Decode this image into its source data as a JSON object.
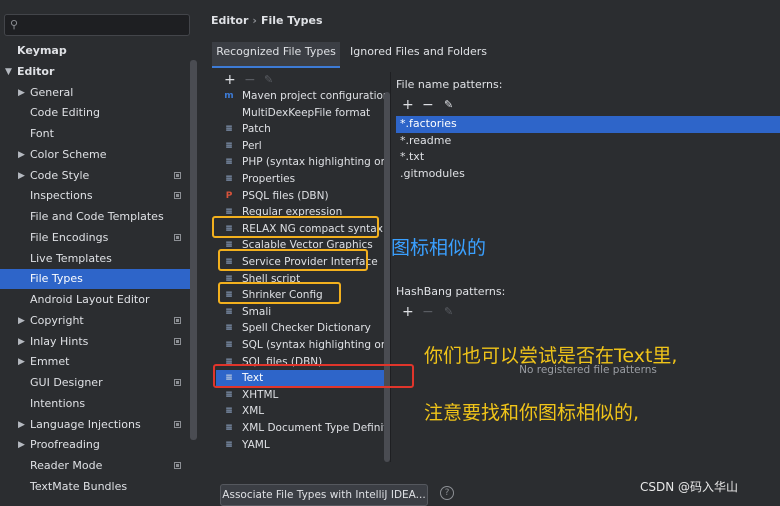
{
  "sidebar": {
    "items": [
      {
        "label": "Keymap",
        "level": 0,
        "bold": true,
        "arrow": "",
        "mark": false
      },
      {
        "label": "Editor",
        "level": 0,
        "bold": true,
        "arrow": "down",
        "mark": false
      },
      {
        "label": "General",
        "level": 1,
        "arrow": "right",
        "mark": false
      },
      {
        "label": "Code Editing",
        "level": 1,
        "arrow": "",
        "mark": false
      },
      {
        "label": "Font",
        "level": 1,
        "arrow": "",
        "mark": false
      },
      {
        "label": "Color Scheme",
        "level": 1,
        "arrow": "right",
        "mark": false
      },
      {
        "label": "Code Style",
        "level": 1,
        "arrow": "right",
        "mark": true
      },
      {
        "label": "Inspections",
        "level": 1,
        "arrow": "",
        "mark": true
      },
      {
        "label": "File and Code Templates",
        "level": 1,
        "arrow": "",
        "mark": false
      },
      {
        "label": "File Encodings",
        "level": 1,
        "arrow": "",
        "mark": true
      },
      {
        "label": "Live Templates",
        "level": 1,
        "arrow": "",
        "mark": false
      },
      {
        "label": "File Types",
        "level": 1,
        "arrow": "",
        "mark": false,
        "selected": true
      },
      {
        "label": "Android Layout Editor",
        "level": 1,
        "arrow": "",
        "mark": false
      },
      {
        "label": "Copyright",
        "level": 1,
        "arrow": "right",
        "mark": true
      },
      {
        "label": "Inlay Hints",
        "level": 1,
        "arrow": "right",
        "mark": true
      },
      {
        "label": "Emmet",
        "level": 1,
        "arrow": "right",
        "mark": false
      },
      {
        "label": "GUI Designer",
        "level": 1,
        "arrow": "",
        "mark": true
      },
      {
        "label": "Intentions",
        "level": 1,
        "arrow": "",
        "mark": false
      },
      {
        "label": "Language Injections",
        "level": 1,
        "arrow": "right",
        "mark": true
      },
      {
        "label": "Proofreading",
        "level": 1,
        "arrow": "right",
        "mark": false
      },
      {
        "label": "Reader Mode",
        "level": 1,
        "arrow": "",
        "mark": true
      },
      {
        "label": "TextMate Bundles",
        "level": 1,
        "arrow": "",
        "mark": false
      }
    ]
  },
  "breadcrumb": {
    "part1": "Editor",
    "sep": "›",
    "part2": "File Types"
  },
  "tabs": {
    "recognized": "Recognized File Types",
    "ignored": "Ignored Files and Folders"
  },
  "toolbar": {
    "add": "+",
    "remove": "−",
    "edit": "✎"
  },
  "file_types": [
    {
      "name": "Maven project configuration",
      "icon": "m",
      "color": "#3d7bd6"
    },
    {
      "name": "MultiDexKeepFile format",
      "icon": "",
      "color": "#2b2d30"
    },
    {
      "name": "Patch",
      "icon": "≡",
      "color": "#8fa6c7"
    },
    {
      "name": "Perl",
      "icon": "≡",
      "color": "#8fa6c7"
    },
    {
      "name": "PHP (syntax highlighting only)",
      "icon": "≡",
      "color": "#8fa6c7"
    },
    {
      "name": "Properties",
      "icon": "≡",
      "color": "#8fa6c7"
    },
    {
      "name": "PSQL files (DBN)",
      "icon": "P",
      "color": "#d9533b"
    },
    {
      "name": "Regular expression",
      "icon": "≡",
      "color": "#8fa6c7"
    },
    {
      "name": "RELAX NG compact syntax",
      "icon": "≡",
      "color": "#8fa6c7"
    },
    {
      "name": "Scalable Vector Graphics",
      "icon": "≡",
      "color": "#8fa6c7"
    },
    {
      "name": "Service Provider Interface",
      "icon": "≡",
      "color": "#8fa6c7"
    },
    {
      "name": "Shell script",
      "icon": "≡",
      "color": "#8fa6c7"
    },
    {
      "name": "Shrinker Config",
      "icon": "≡",
      "color": "#8fa6c7"
    },
    {
      "name": "Smali",
      "icon": "≡",
      "color": "#8fa6c7"
    },
    {
      "name": "Spell Checker Dictionary",
      "icon": "≡",
      "color": "#8fa6c7"
    },
    {
      "name": "SQL (syntax highlighting only)",
      "icon": "≡",
      "color": "#8fa6c7"
    },
    {
      "name": "SQL files (DBN)",
      "icon": "≡",
      "color": "#8fa6c7"
    },
    {
      "name": "Text",
      "icon": "≡",
      "color": "#cfd6e0",
      "selected": true
    },
    {
      "name": "XHTML",
      "icon": "≡",
      "color": "#8fa6c7"
    },
    {
      "name": "XML",
      "icon": "≡",
      "color": "#8fa6c7"
    },
    {
      "name": "XML Document Type Definition",
      "icon": "≡",
      "color": "#8fa6c7"
    },
    {
      "name": "YAML",
      "icon": "≡",
      "color": "#8fa6c7"
    }
  ],
  "patterns": {
    "title": "File name patterns:",
    "items": [
      "*.factories",
      "*.readme",
      "*.txt",
      ".gitmodules"
    ]
  },
  "hashbang": {
    "title": "HashBang patterns:",
    "empty": "No registered file patterns"
  },
  "assoc_button": "Associate File Types with IntelliJ IDEA...",
  "help": "?",
  "annotations": {
    "note1": "图标相似的",
    "note2": "你们也可以尝试是否在Text里,",
    "note3": "注意要找和你图标相似的,",
    "watermark": "CSDN @码入华山"
  },
  "colors": {
    "accent": "#2e65c9",
    "highlight_yellow": "#f2b01e",
    "highlight_red": "#e0352b"
  }
}
